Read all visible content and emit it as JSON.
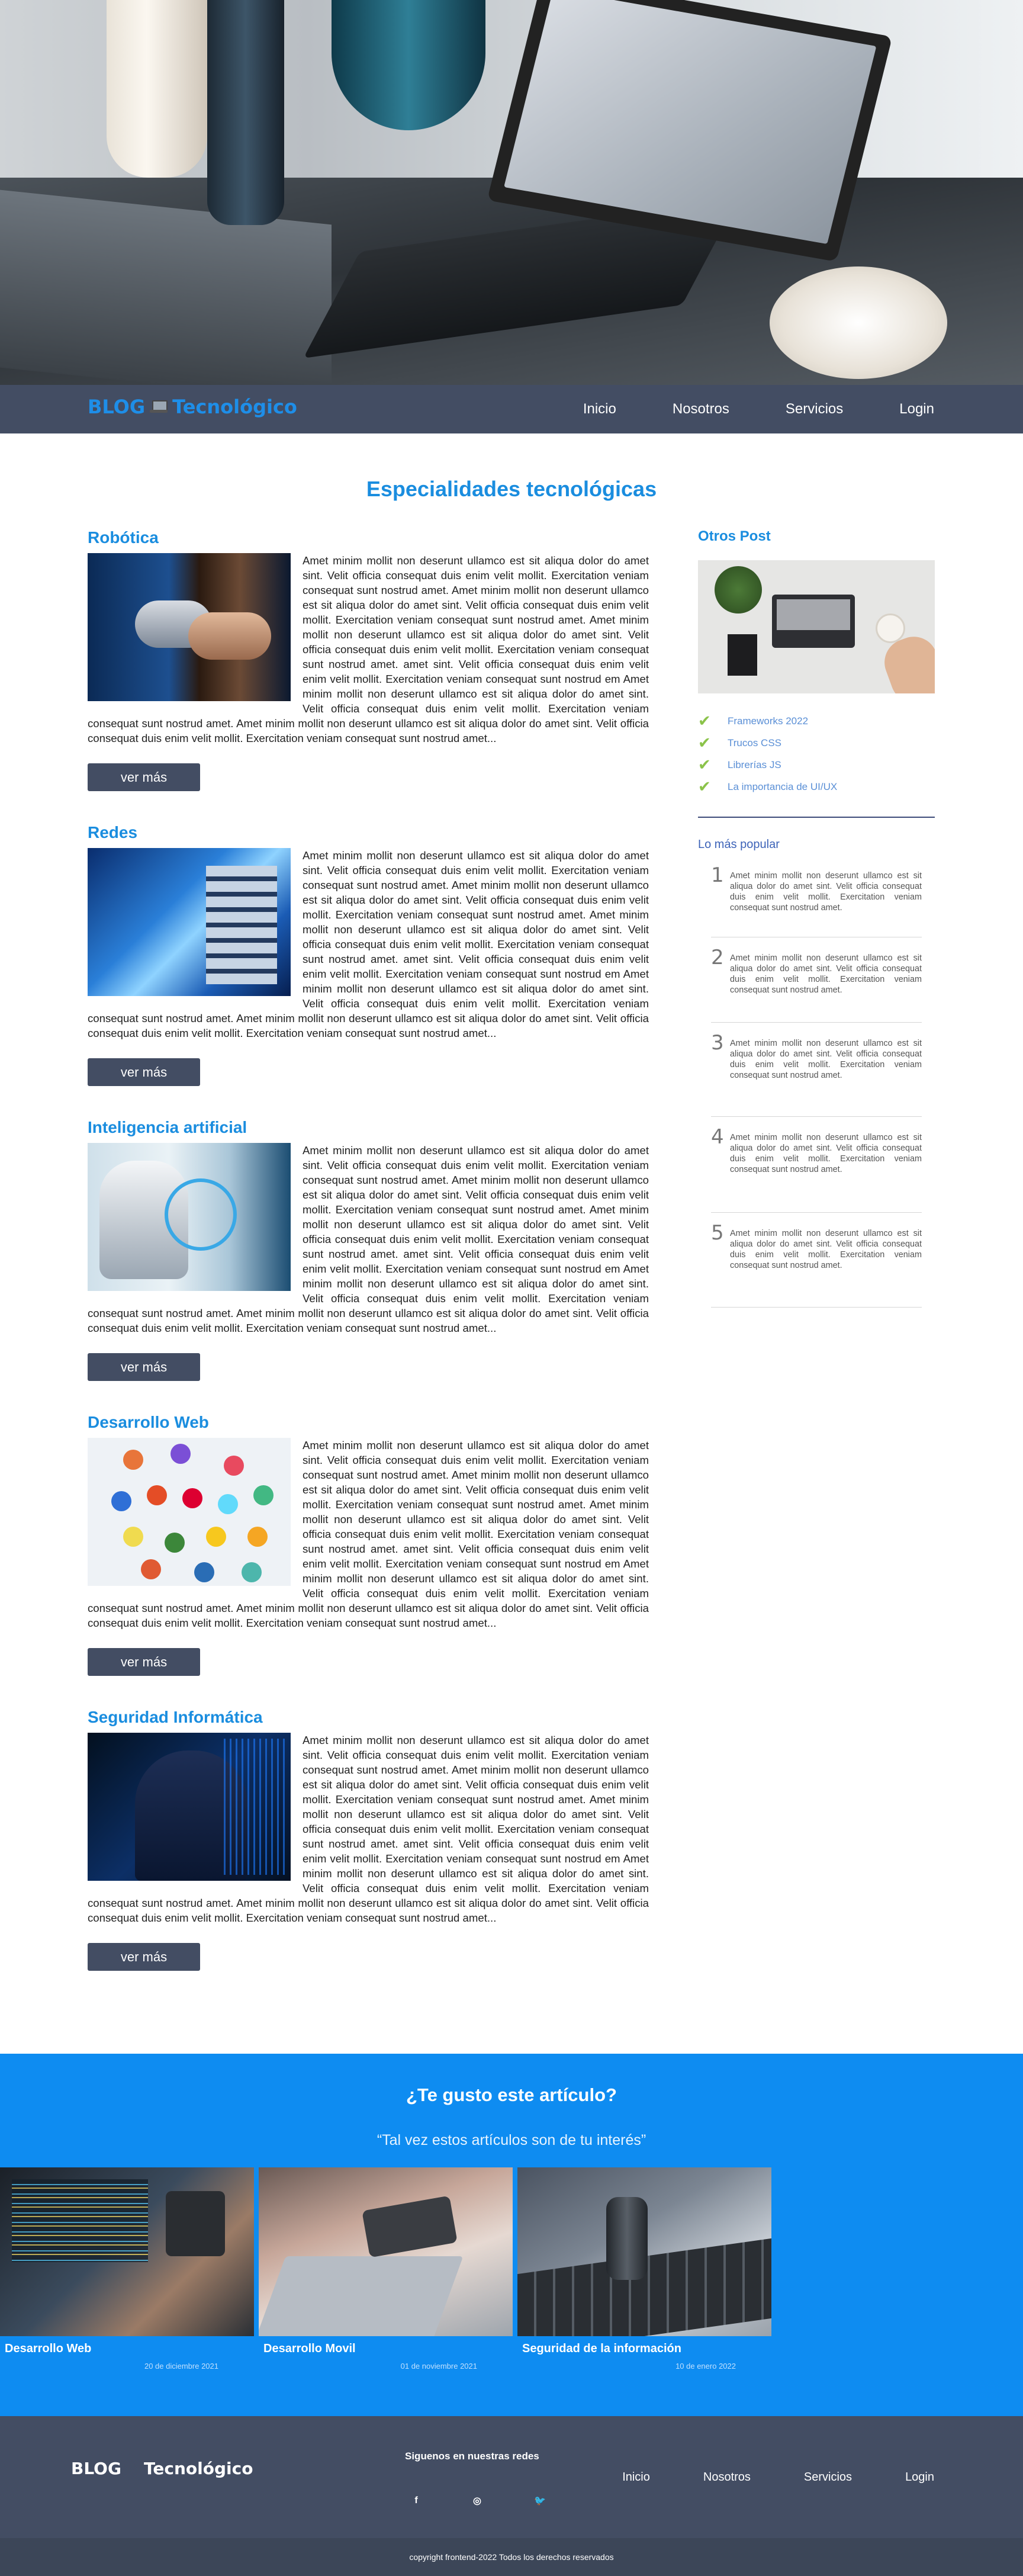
{
  "nav": {
    "logo_blog": "BLOG",
    "logo_tech": "Tecnológico",
    "links": [
      "Inicio",
      "Nosotros",
      "Servicios",
      "Login"
    ]
  },
  "main": {
    "title": "Especialidades tecnológicas",
    "articles": [
      {
        "title": "Robótica",
        "body": "Amet minim mollit non deserunt ullamco est sit aliqua dolor do amet sint. Velit officia consequat duis enim velit mollit. Exercitation veniam consequat sunt nostrud amet. Amet minim mollit non deserunt ullamco est sit aliqua dolor do amet sint. Velit officia consequat duis enim velit mollit. Exercitation veniam consequat sunt nostrud amet. Amet minim mollit non deserunt ullamco est sit aliqua dolor do amet sint. Velit officia consequat duis enim velit mollit. Exercitation veniam consequat sunt nostrud amet. amet sint. Velit officia consequat duis enim velit enim velit mollit. Exercitation veniam consequat sunt nostrud em Amet minim mollit non deserunt ullamco est sit aliqua dolor do amet sint. Velit officia consequat duis enim velit mollit. Exercitation veniam consequat sunt nostrud amet. Amet minim mollit non deserunt ullamco est sit aliqua dolor do amet sint. Velit officia consequat duis enim velit mollit. Exercitation veniam consequat sunt nostrud amet...",
        "button": "ver más"
      },
      {
        "title": "Redes",
        "body": "Amet minim mollit non deserunt ullamco est sit aliqua dolor do amet sint. Velit officia consequat duis enim velit mollit. Exercitation veniam consequat sunt nostrud amet. Amet minim mollit non deserunt ullamco est sit aliqua dolor do amet sint. Velit officia consequat duis enim velit mollit. Exercitation veniam consequat sunt nostrud amet. Amet minim mollit non deserunt ullamco est sit aliqua dolor do amet sint. Velit officia consequat duis enim velit mollit. Exercitation veniam consequat sunt nostrud amet. amet sint. Velit officia consequat duis enim velit enim velit mollit. Exercitation veniam consequat sunt nostrud em Amet minim mollit non deserunt ullamco est sit aliqua dolor do amet sint. Velit officia consequat duis enim velit mollit. Exercitation veniam consequat sunt nostrud amet. Amet minim mollit non deserunt ullamco est sit aliqua dolor do amet sint. Velit officia consequat duis enim velit mollit. Exercitation veniam consequat sunt nostrud amet...",
        "button": "ver más"
      },
      {
        "title": "Inteligencia artificial",
        "body": "Amet minim mollit non deserunt ullamco est sit aliqua dolor do amet sint. Velit officia consequat duis enim velit mollit. Exercitation veniam consequat sunt nostrud amet. Amet minim mollit non deserunt ullamco est sit aliqua dolor do amet sint. Velit officia consequat duis enim velit mollit. Exercitation veniam consequat sunt nostrud amet. Amet minim mollit non deserunt ullamco est sit aliqua dolor do amet sint. Velit officia consequat duis enim velit mollit. Exercitation veniam consequat sunt nostrud amet. amet sint. Velit officia consequat duis enim velit enim velit mollit. Exercitation veniam consequat sunt nostrud em Amet minim mollit non deserunt ullamco est sit aliqua dolor do amet sint. Velit officia consequat duis enim velit mollit. Exercitation veniam consequat sunt nostrud amet. Amet minim mollit non deserunt ullamco est sit aliqua dolor do amet sint. Velit officia consequat duis enim velit mollit. Exercitation veniam consequat sunt nostrud amet...",
        "button": "ver más"
      },
      {
        "title": "Desarrollo Web",
        "body": "Amet minim mollit non deserunt ullamco est sit aliqua dolor do amet sint. Velit officia consequat duis enim velit mollit. Exercitation veniam consequat sunt nostrud amet. Amet minim mollit non deserunt ullamco est sit aliqua dolor do amet sint. Velit officia consequat duis enim velit mollit. Exercitation veniam consequat sunt nostrud amet. Amet minim mollit non deserunt ullamco est sit aliqua dolor do amet sint. Velit officia consequat duis enim velit mollit. Exercitation veniam consequat sunt nostrud amet. amet sint. Velit officia consequat duis enim velit enim velit mollit. Exercitation veniam consequat sunt nostrud em Amet minim mollit non deserunt ullamco est sit aliqua dolor do amet sint. Velit officia consequat duis enim velit mollit. Exercitation veniam consequat sunt nostrud amet. Amet minim mollit non deserunt ullamco est sit aliqua dolor do amet sint. Velit officia consequat duis enim velit mollit. Exercitation veniam consequat sunt nostrud amet...",
        "button": "ver más"
      },
      {
        "title": "Seguridad Informática",
        "body": "Amet minim mollit non deserunt ullamco est sit aliqua dolor do amet sint. Velit officia consequat duis enim velit mollit. Exercitation veniam consequat sunt nostrud amet. Amet minim mollit non deserunt ullamco est sit aliqua dolor do amet sint. Velit officia consequat duis enim velit mollit. Exercitation veniam consequat sunt nostrud amet. Amet minim mollit non deserunt ullamco est sit aliqua dolor do amet sint. Velit officia consequat duis enim velit mollit. Exercitation veniam consequat sunt nostrud amet. amet sint. Velit officia consequat duis enim velit enim velit mollit. Exercitation veniam consequat sunt nostrud em Amet minim mollit non deserunt ullamco est sit aliqua dolor do amet sint. Velit officia consequat duis enim velit mollit. Exercitation veniam consequat sunt nostrud amet. Amet minim mollit non deserunt ullamco est sit aliqua dolor do amet sint. Velit officia consequat duis enim velit mollit. Exercitation veniam consequat sunt nostrud amet...",
        "button": "ver más"
      }
    ]
  },
  "sidebar": {
    "other_title": "Otros Post",
    "other_links": [
      "Frameworks 2022",
      "Trucos CSS",
      "Librerías JS",
      "La importancia de UI/UX"
    ],
    "popular_title": "Lo más popular",
    "popular": [
      {
        "num": "1",
        "text": "Amet minim mollit non deserunt ullamco est sit aliqua dolor do amet sint. Velit officia consequat duis enim velit mollit. Exercitation veniam consequat sunt nostrud amet."
      },
      {
        "num": "2",
        "text": "Amet minim mollit non deserunt ullamco est sit aliqua dolor do amet sint. Velit officia consequat duis enim velit mollit. Exercitation veniam consequat sunt nostrud amet."
      },
      {
        "num": "3",
        "text": "Amet minim mollit non deserunt ullamco est sit aliqua dolor do amet sint. Velit officia consequat duis enim velit mollit. Exercitation veniam consequat sunt nostrud amet."
      },
      {
        "num": "4",
        "text": "Amet minim mollit non deserunt ullamco est sit aliqua dolor do amet sint. Velit officia consequat duis enim velit mollit. Exercitation veniam consequat sunt nostrud amet."
      },
      {
        "num": "5",
        "text": "Amet minim mollit non deserunt ullamco est sit aliqua dolor do amet sint. Velit officia consequat duis enim velit mollit. Exercitation veniam consequat sunt nostrud amet."
      }
    ]
  },
  "related": {
    "title": "¿Te gusto este artículo?",
    "subtitle": "“Tal vez estos artículos son de tu interés”",
    "cards": [
      {
        "title": "Desarrollo Web",
        "date": "20 de diciembre 2021"
      },
      {
        "title": "Desarrollo Movil",
        "date": "01 de noviembre 2021"
      },
      {
        "title": "Seguridad de la información",
        "date": "10 de enero 2022"
      }
    ]
  },
  "footer": {
    "logo_blog": "BLOG",
    "logo_tech": "Tecnológico",
    "follow": "Siguenos en nuestras redes",
    "social": [
      {
        "icon": "facebook-icon",
        "glyph": "f"
      },
      {
        "icon": "instagram-icon",
        "glyph": "◎"
      },
      {
        "icon": "twitter-icon",
        "glyph": "🐦"
      }
    ],
    "links": [
      "Inicio",
      "Nosotros",
      "Servicios",
      "Login"
    ],
    "copyright": "copyright frontend-2022 Todos los derechos reservados"
  },
  "colors": {
    "accent": "#1a8ddf",
    "nav_bg": "#434d63",
    "related_bg": "#0e8cf1",
    "check": "#8bc34a"
  }
}
